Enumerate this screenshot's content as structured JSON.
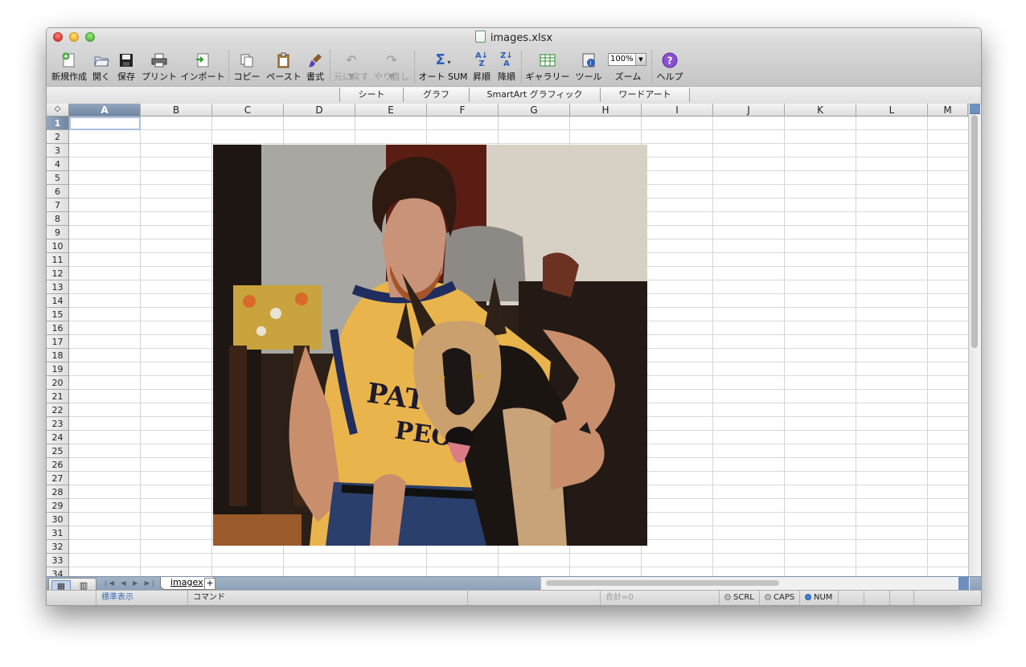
{
  "window": {
    "title": "images.xlsx"
  },
  "toolbar": {
    "new": "新規作成",
    "open": "開く",
    "save": "保存",
    "print": "プリント",
    "import": "インポート",
    "copy": "コピー",
    "paste": "ペースト",
    "format": "書式",
    "undo": "元に戻す",
    "redo": "やり直し",
    "autosum": "オート SUM",
    "sort_asc": "昇順",
    "sort_desc": "降順",
    "gallery": "ギャラリー",
    "tools": "ツール",
    "zoom_label": "ズーム",
    "zoom_value": "100%",
    "help": "ヘルプ"
  },
  "ribbon": {
    "tabs": [
      "シート",
      "グラフ",
      "SmartArt グラフィック",
      "ワードアート"
    ]
  },
  "grid": {
    "columns": [
      "A",
      "B",
      "C",
      "D",
      "E",
      "F",
      "G",
      "H",
      "I",
      "J",
      "K",
      "L",
      "M"
    ],
    "rows": [
      "1",
      "2",
      "3",
      "4",
      "5",
      "6",
      "7",
      "8",
      "9",
      "10",
      "11",
      "12",
      "13",
      "14",
      "15",
      "16",
      "17",
      "18",
      "19",
      "20",
      "21",
      "22",
      "23",
      "24",
      "25",
      "26",
      "27",
      "28",
      "29",
      "30",
      "31",
      "32",
      "33",
      "34"
    ],
    "selected_cell": "A1"
  },
  "sheet_tabs": {
    "active": "imagex",
    "add": "+"
  },
  "status": {
    "view": "標準表示",
    "mode": "コマンド",
    "sum": "合計=0",
    "scrl": "SCRL",
    "caps": "CAPS",
    "num": "NUM"
  },
  "icons": {
    "new": "new-sheet-icon",
    "open": "open-folder-icon",
    "save": "floppy-disk-icon",
    "print": "printer-icon",
    "import": "import-icon",
    "copy": "copy-icon",
    "paste": "clipboard-icon",
    "format": "paintbrush-icon",
    "undo": "undo-arrow-icon",
    "redo": "redo-arrow-icon",
    "autosum": "sigma-icon",
    "sort_asc": "sort-ascending-icon",
    "sort_desc": "sort-descending-icon",
    "gallery": "gallery-icon",
    "tools": "toolbox-icon",
    "help": "question-mark-icon"
  },
  "colors": {
    "selection_header": "#6f86a3",
    "tab_bar": "#8ba0b8",
    "scroll_accent": "#6e8fbf",
    "help_purple": "#8a4fd0"
  }
}
